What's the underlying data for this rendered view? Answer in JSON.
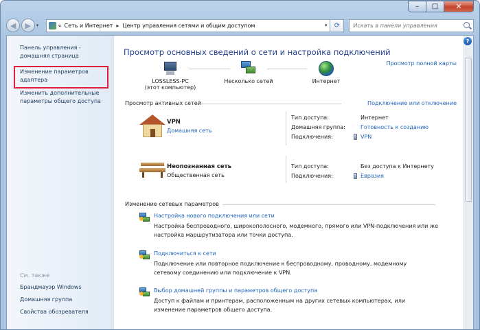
{
  "address": {
    "crumbs": [
      "Сеть и Интернет",
      "Центр управления сетями и общим доступом"
    ],
    "nav_chevron": "«",
    "separator": "▸",
    "search_placeholder": "Искать в панели управления"
  },
  "sidebar": {
    "home_link_line1": "Панель управления -",
    "home_link_line2": "домашняя страница",
    "adapter_link_line1": "Изменение параметров",
    "adapter_link_line2": "адаптера",
    "sharing_link_line1": "Изменить дополнительные",
    "sharing_link_line2": "параметры общего доступа",
    "see_also": "См. также",
    "see_also_items": [
      "Брандмауэр Windows",
      "Домашняя группа",
      "Свойства обозревателя"
    ]
  },
  "main": {
    "title": "Просмотр основных сведений о сети и настройка подключений",
    "full_map_link": "Просмотр полной карты",
    "map_nodes": [
      {
        "label_line1": "LOSSLESS-PC",
        "label_line2": "(этот компьютер)",
        "icon": "computer-icon"
      },
      {
        "label_line1": "Несколько сетей",
        "icon": "multiple-networks-icon"
      },
      {
        "label_line1": "Интернет",
        "icon": "globe-icon"
      }
    ],
    "active_networks_header": "Просмотр активных сетей",
    "connect_disconnect_link": "Подключение или отключение",
    "networks": [
      {
        "name": "VPN",
        "type_link": "Домашняя сеть",
        "icon": "home-icon",
        "props": [
          {
            "label": "Тип доступа:",
            "value": "Интернет",
            "is_link": false
          },
          {
            "label": "Домашняя группа:",
            "value": "Готовность к созданию",
            "is_link": true
          },
          {
            "label": "Подключения:",
            "value": "VPN",
            "is_link": true
          }
        ]
      },
      {
        "name": "Неопознанная сеть",
        "type_text": "Общественная сеть",
        "icon": "bench-icon",
        "props": [
          {
            "label": "Тип доступа:",
            "value": "Без доступа к Интернету",
            "is_link": false
          },
          {
            "label": "Подключения:",
            "value": "Евразия",
            "is_link": true
          }
        ]
      }
    ],
    "change_settings_header": "Изменение сетевых параметров",
    "tasks": [
      {
        "title": "Настройка нового подключения или сети",
        "desc": "Настройка беспроводного, широкополосного, модемного, прямого или VPN-подключения или же настройка маршрутизатора или точки доступа."
      },
      {
        "title": "Подключиться к сети",
        "desc": "Подключение или повторное подключение к беспроводному, проводному, модемному сетевому соединению или подключение к VPN."
      },
      {
        "title": "Выбор домашней группы и параметров общего доступа",
        "desc": "Доступ к файлам и принтерам, расположенным на других сетевых компьютерах, или изменение параметров общего доступа."
      }
    ]
  },
  "icons": {
    "help": "?",
    "minimize": "–",
    "maximize": "□",
    "close": "✕",
    "refresh": "⟳",
    "dropdown": "▾"
  },
  "colors": {
    "link": "#1e63b8",
    "title": "#1f3e8c",
    "highlight": "#e0203a"
  }
}
